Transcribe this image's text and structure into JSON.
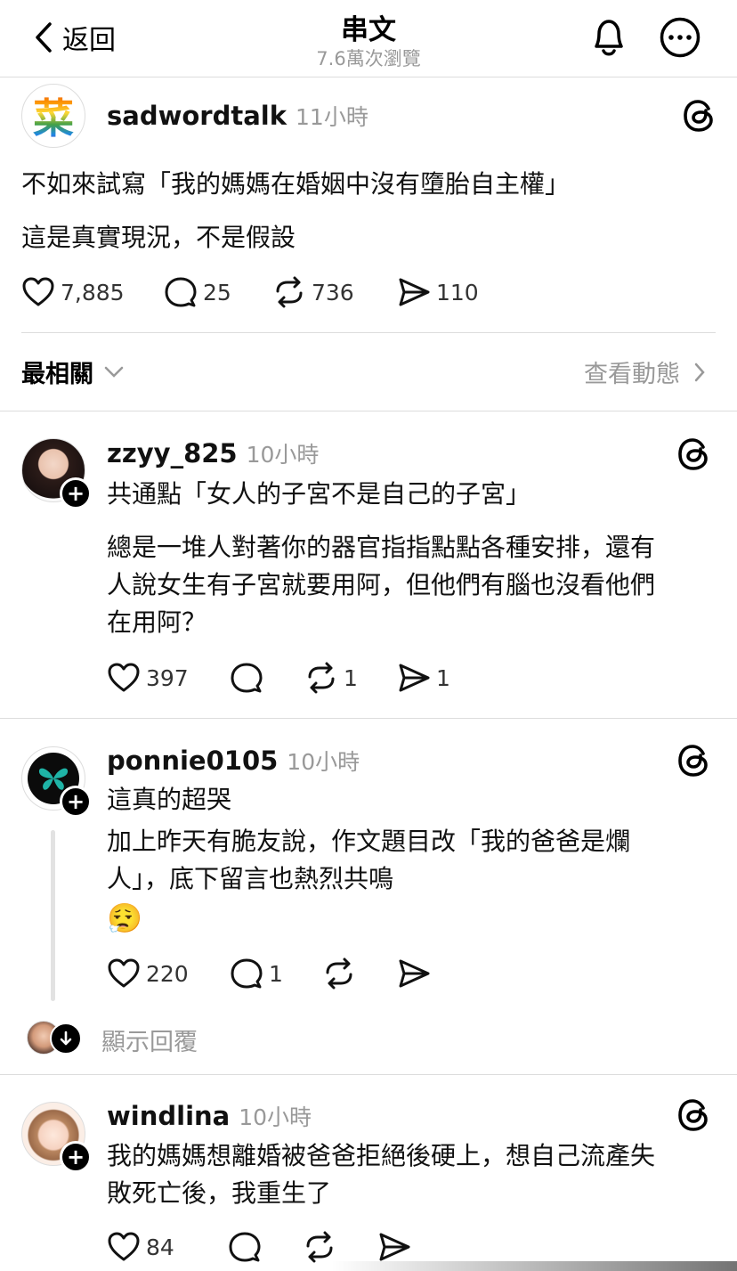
{
  "header": {
    "back_label": "返回",
    "title": "串文",
    "views": "7.6萬次瀏覽"
  },
  "main_post": {
    "avatar_char": "菜",
    "username": "sadwordtalk",
    "time": "11小時",
    "lines": [
      "不如來試寫「我的媽媽在婚姻中沒有墮胎自主權」",
      "這是真實現況，不是假設"
    ],
    "likes": "7,885",
    "comments": "25",
    "reposts": "736",
    "shares": "110"
  },
  "sort_bar": {
    "label": "最相關",
    "activity_link": "查看動態"
  },
  "replies": [
    {
      "username": "zzyy_825",
      "time": "10小時",
      "lines": [
        "共通點「女人的子宮不是自己的子宮」",
        "總是一堆人對著你的器官指指點點各種安排，還有",
        "人說女生有子宮就要用阿，但他們有腦也沒看他們",
        "在用阿？"
      ],
      "likes": "397",
      "comments": "",
      "reposts": "1",
      "shares": "1"
    },
    {
      "username": "ponnie0105",
      "time": "10小時",
      "lines": [
        "這真的超哭",
        "加上昨天有脆友說，作文題目改「我的爸爸是爛",
        "人」，底下留言也熱烈共鳴",
        "😮‍💨"
      ],
      "likes": "220",
      "comments": "1",
      "reposts": "",
      "shares": "",
      "show_replies": "顯示回覆"
    },
    {
      "username": "windlina",
      "time": "10小時",
      "lines": [
        "我的媽媽想離婚被爸爸拒絕後硬上，想自己流產失",
        "敗死亡後，我重生了"
      ],
      "likes": "84",
      "comments": "",
      "reposts": "",
      "shares": ""
    }
  ]
}
